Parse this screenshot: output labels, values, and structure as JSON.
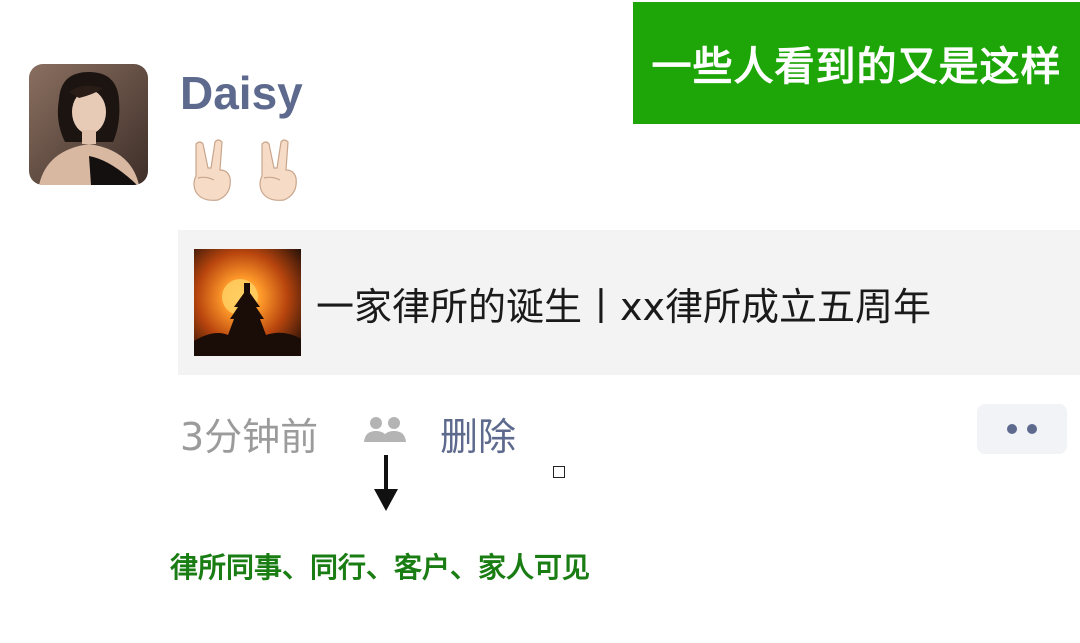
{
  "banner": {
    "text": "一些人看到的又是这样",
    "color": "#1ea608"
  },
  "post": {
    "username": "Daisy",
    "emojis": [
      "victory-hand",
      "victory-hand"
    ],
    "link_card": {
      "title": "一家律所的诞生丨xx律所成立五周年"
    },
    "time": "3分钟前",
    "delete_label": "删除"
  },
  "annotation": {
    "caption": "律所同事、同行、客户、家人可见"
  },
  "colors": {
    "name_link": "#5d6a8e",
    "caption_green": "#1a7d14",
    "card_bg": "#f3f3f3"
  }
}
